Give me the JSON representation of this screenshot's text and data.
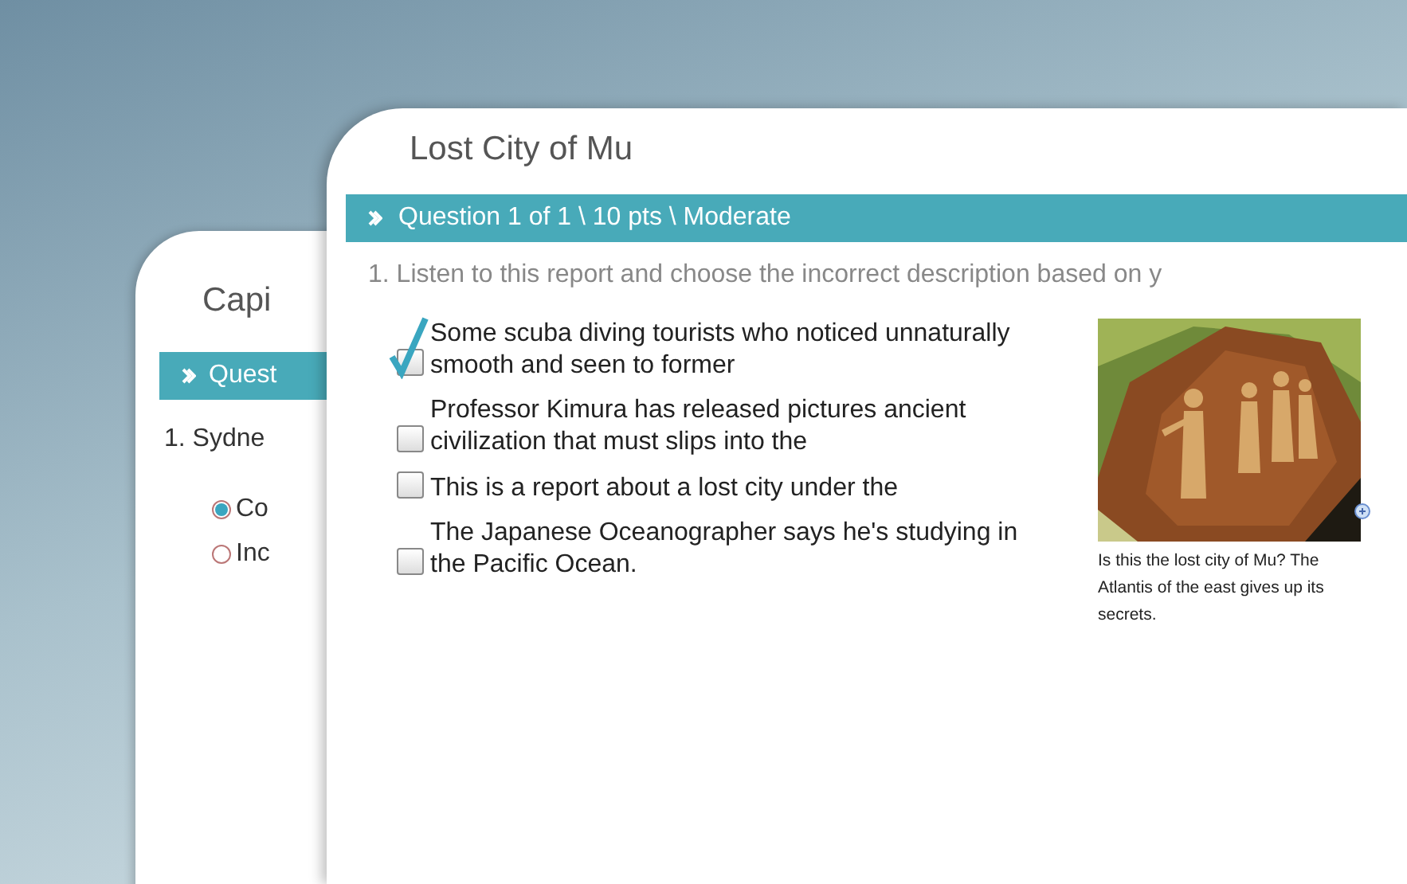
{
  "back_quiz": {
    "title": "Capi",
    "question_bar": "Quest",
    "question": "1. Sydne",
    "choices": [
      {
        "label": "Co",
        "selected": true
      },
      {
        "label": "Inc",
        "selected": false
      }
    ]
  },
  "quiz": {
    "title": "Lost City of Mu",
    "question_bar": "Question 1 of 1 \\ 10 pts \\ Moderate",
    "question": "1. Listen to this report and choose the incorrect description based on y",
    "options": [
      {
        "label": "Some scuba diving tourists who noticed unnaturally smooth and seen to former",
        "checked": true
      },
      {
        "label": "Professor Kimura  has released pictures ancient civilization that must slips into the",
        "checked": false
      },
      {
        "label": "This is a report about a lost city under the",
        "checked": false
      },
      {
        "label": "The Japanese Oceanographer says he's studying in the Pacific Ocean.",
        "checked": false
      }
    ],
    "image": {
      "caption": "Is this the lost city of Mu? The Atlantis of the east gives up its secrets."
    }
  }
}
